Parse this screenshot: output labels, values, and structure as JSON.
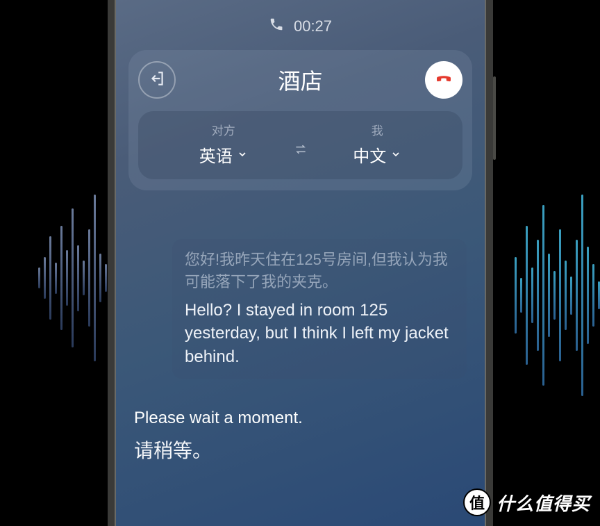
{
  "call": {
    "duration": "00:27"
  },
  "header": {
    "title": "酒店"
  },
  "languages": {
    "other_label": "对方",
    "other_value": "英语",
    "self_label": "我",
    "self_value": "中文"
  },
  "messages": [
    {
      "side": "right",
      "original": "您好!我昨天住在125号房间,但我认为我可能落下了我的夹克。",
      "translated": "Hello? I stayed in room 125 yesterday, but I think I left my jacket behind."
    },
    {
      "side": "left",
      "original": "Please wait a moment.",
      "translated": "请稍等。"
    }
  ],
  "watermark": {
    "badge": "值",
    "text": "什么值得买"
  }
}
